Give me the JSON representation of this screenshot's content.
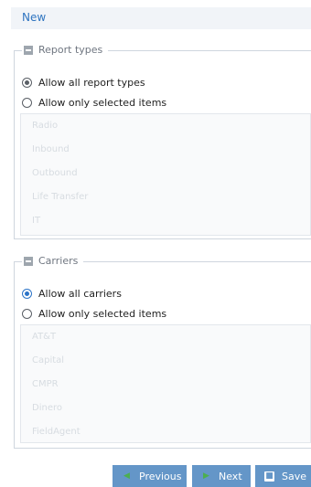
{
  "header": {
    "title": "New"
  },
  "report_types": {
    "legend": "Report types",
    "options": [
      {
        "label": "Allow all report types",
        "checked": true
      },
      {
        "label": "Allow only selected items",
        "checked": false
      }
    ],
    "items": [
      "Radio",
      "Inbound",
      "Outbound",
      "Life Transfer",
      "IT"
    ]
  },
  "carriers": {
    "legend": "Carriers",
    "options": [
      {
        "label": "Allow all carriers",
        "checked": true
      },
      {
        "label": "Allow only selected items",
        "checked": false
      }
    ],
    "items": [
      "AT&T",
      "Capital",
      "CMPR",
      "Dinero",
      "FieldAgent"
    ]
  },
  "buttons": {
    "previous": "Previous",
    "next": "Next",
    "save": "Save"
  }
}
